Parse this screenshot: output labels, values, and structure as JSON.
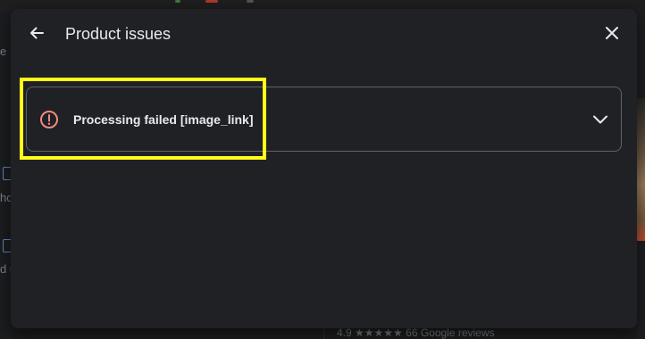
{
  "dialog": {
    "title": "Product issues",
    "back_icon": "arrow-back-icon",
    "close_icon": "close-icon"
  },
  "issues": [
    {
      "label": "Processing failed [image_link]",
      "status_icon": "error-circle-icon",
      "expand_icon": "chevron-down-icon",
      "expanded": false
    }
  ],
  "background": {
    "bottom_fragment": "4.9 ★★★★★ 66 Google reviews"
  },
  "colors": {
    "dialog_bg": "#202124",
    "text": "#e8eaed",
    "card_border": "#5f6368",
    "error": "#f28b82",
    "highlight": "#ffff1a"
  }
}
